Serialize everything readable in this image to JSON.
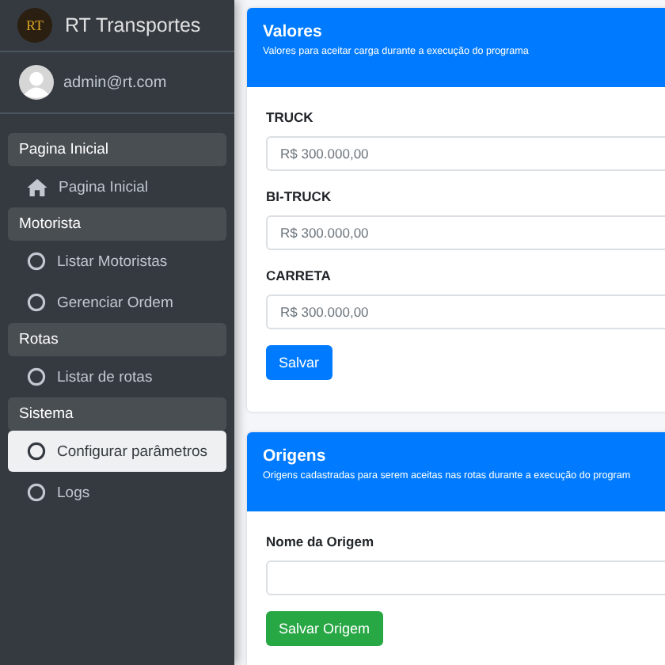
{
  "brand": {
    "logo": "RT",
    "name": "RT Transportes"
  },
  "user": {
    "name": "admin@rt.com"
  },
  "nav": [
    {
      "header": "Pagina Inicial",
      "items": [
        {
          "kind": "home",
          "label": "Pagina Inicial",
          "selected": false
        }
      ]
    },
    {
      "header": "Motorista",
      "items": [
        {
          "kind": "circle",
          "label": "Listar Motoristas",
          "selected": false
        },
        {
          "kind": "circle",
          "label": "Gerenciar Ordem",
          "selected": false
        }
      ]
    },
    {
      "header": "Rotas",
      "items": [
        {
          "kind": "circle",
          "label": "Listar de rotas",
          "selected": false
        }
      ]
    },
    {
      "header": "Sistema",
      "items": [
        {
          "kind": "circle",
          "label": "Configurar parâmetros",
          "selected": true
        },
        {
          "kind": "circle",
          "label": "Logs",
          "selected": false
        }
      ]
    }
  ],
  "cards": [
    {
      "title": "Valores",
      "subtitle": "Valores para aceitar carga durante a execução do programa",
      "fields": [
        {
          "label": "TRUCK",
          "value": "R$ 300.000,00"
        },
        {
          "label": "BI-TRUCK",
          "value": "R$ 300.000,00"
        },
        {
          "label": "CARRETA",
          "value": "R$ 300.000,00"
        }
      ],
      "button": {
        "label": "Salvar",
        "kind": "primary"
      }
    },
    {
      "title": "Origens",
      "subtitle": "Origens cadastradas para serem aceitas nas rotas durante a execução do program",
      "fields": [
        {
          "label": "Nome da Origem"
        }
      ],
      "button": {
        "label": "Salvar Origem",
        "kind": "success"
      }
    }
  ]
}
